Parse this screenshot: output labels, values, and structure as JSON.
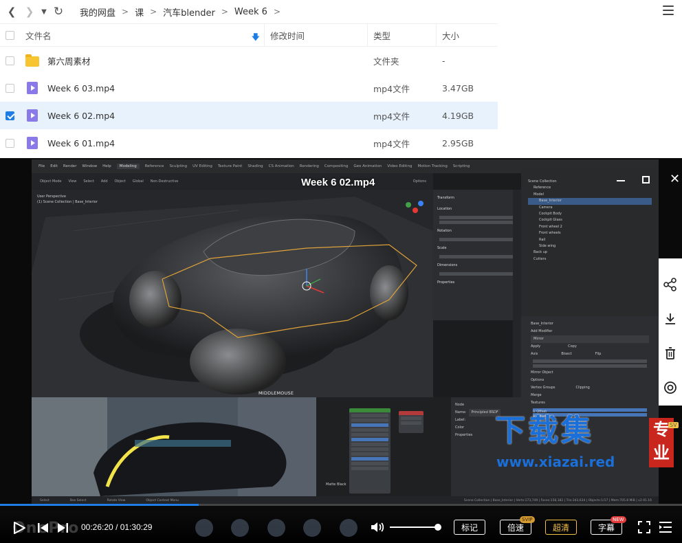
{
  "nav": {
    "breadcrumbs": [
      "我的网盘",
      "课",
      "汽车blender",
      "Week 6"
    ]
  },
  "list": {
    "headers": {
      "name": "文件名",
      "mtime": "修改时间",
      "type": "类型",
      "size": "大小"
    },
    "rows": [
      {
        "name": "第六周素材",
        "type": "文件夹",
        "size": "-",
        "kind": "folder",
        "checked": false
      },
      {
        "name": "Week 6 03.mp4",
        "type": "mp4文件",
        "size": "3.47GB",
        "kind": "video",
        "checked": false
      },
      {
        "name": "Week 6 02.mp4",
        "type": "mp4文件",
        "size": "4.19GB",
        "kind": "video",
        "checked": true
      },
      {
        "name": "Week 6 01.mp4",
        "type": "mp4文件",
        "size": "2.95GB",
        "kind": "video",
        "checked": false
      }
    ]
  },
  "player": {
    "title": "Week 6 02.mp4",
    "current_time": "00:26:20",
    "total_time": "01:30:29",
    "progress_fraction": 0.291,
    "volume_fraction": 0.95,
    "buttons": {
      "mark": "标记",
      "speed": "倍速",
      "quality": "超清",
      "subtitle": "字幕"
    },
    "badges": {
      "speed": "SVIP",
      "subtitle": "NEW"
    },
    "overlay_logo": "OnePro"
  },
  "blender": {
    "menu": [
      "File",
      "Edit",
      "Render",
      "Window",
      "Help"
    ],
    "workspaces": [
      "Modeling",
      "Reference",
      "Sculpting",
      "UV Editing",
      "Texture Paint",
      "Shading",
      "CS Animation",
      "Rendering",
      "Compositing",
      "Geo Animation",
      "Video Editing",
      "Motion Tracking",
      "Scripting"
    ],
    "toolbar": [
      "Object Mode",
      "View",
      "Select",
      "Add",
      "Object",
      "Global",
      "Non-Destructive",
      "Options"
    ],
    "viewport_info": [
      "User Perspective",
      "(1) Scene Collection | Base_Interior"
    ],
    "middlemouse": "MIDDLEMOUSE",
    "npanel": [
      "Transform",
      "Location",
      "Rotation",
      "Scale",
      "Dimensions",
      "Properties"
    ],
    "outliner": [
      "Scene Collection",
      "Reference",
      "Model",
      "Base_Interior",
      "Camera",
      "Cockpit Body",
      "Cockpit Glass",
      "Front wheel 2",
      "Front wheels",
      "Rail",
      "Side wing",
      "Back up",
      "Cutters"
    ],
    "properties": [
      "Base_Interior",
      "Add Modifier",
      "Mirror",
      "Apply",
      "Copy",
      "Axis",
      "Bisect",
      "Flip",
      "Mirror Object",
      "Options",
      "Vertex Groups",
      "Clipping",
      "Merge",
      "Textures",
      "U Offset",
      "V Offset"
    ],
    "node_header": [
      "Node",
      "Name:",
      "Principled BSDF",
      "Label:",
      "Color",
      "Properties"
    ],
    "status": [
      "Select",
      "Box Select",
      "Rotate View",
      "Object Context Menu",
      "Scene Collection | Base_Interior | Verts:173,749 | Faces:158,182 | Tris:343,634 | Objects:1/17 | Mem:705.8 MiB | v2.91.16"
    ],
    "matte": "Matte Black"
  },
  "watermark": {
    "text": "下载集",
    "url": "www.xiazai.red",
    "seal": "专业",
    "seal_badge": "SV"
  },
  "colors": {
    "accent": "#1e7ee6",
    "selected_row": "#e8f2fc",
    "folder": "#f7c531",
    "video_file": "#8a79e8",
    "gold": "#f5c24a"
  }
}
